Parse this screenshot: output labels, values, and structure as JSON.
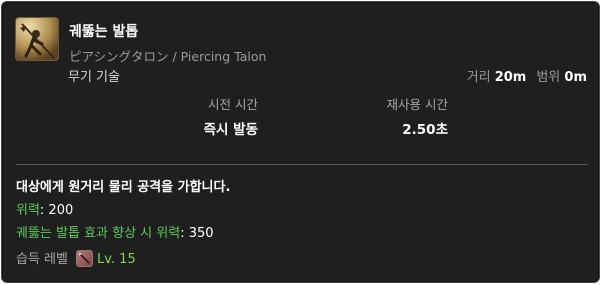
{
  "action": {
    "icon": "piercing-talon-icon",
    "name": "궤뚫는 발톱",
    "subtitle": "ピアシングタロン / Piercing Talon",
    "category": "무기 기술",
    "range_label": "거리",
    "range_value": "20m",
    "radius_label": "범위",
    "radius_value": "0m",
    "cast_label": "시전 시간",
    "cast_value": "즉시 발동",
    "recast_label": "재사용 시간",
    "recast_value": "2.50초",
    "description": "대상에게 원거리 물리 공격을 가합니다.",
    "potency_label": "위력",
    "potency_value": ": 200",
    "bonus_label": "궤뚫는 발톱 효과 향상 시 위력",
    "bonus_value": ": 350",
    "acquired_label": "습득 레벨",
    "job_icon": "dragoon-job-icon",
    "level": "Lv. 15"
  },
  "colors": {
    "background": "#1f1f1f",
    "highlight_green": "#5cc75c",
    "level_green": "#7fd64a"
  }
}
